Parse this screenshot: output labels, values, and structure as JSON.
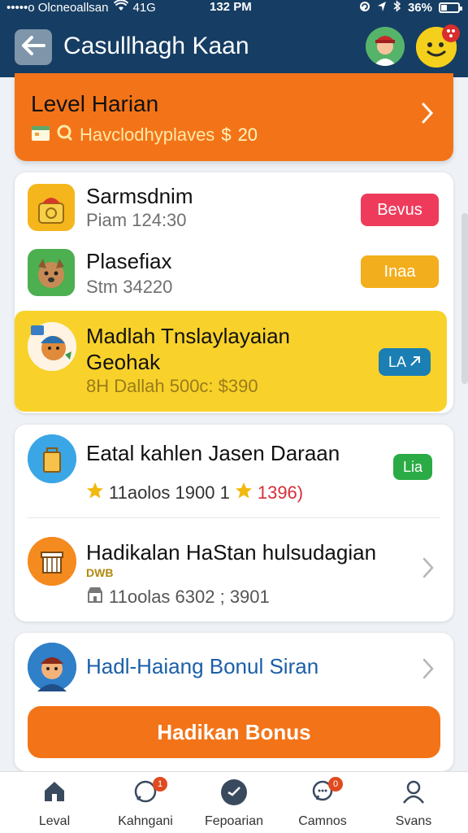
{
  "status_bar": {
    "carrier": "•••••o Olcneoallsan",
    "network": "41G",
    "time": "132 PM",
    "battery": "36%",
    "battery_level": 0.36
  },
  "header": {
    "title": "Casullhagh Kaan"
  },
  "notification_badge": {
    "color": "#d92e2e"
  },
  "level_card": {
    "title": "Level Harian",
    "subtitle": "Havclodhyplaves",
    "currency": "$",
    "amount": "20"
  },
  "list_1": [
    {
      "title": "Sarmsdnim",
      "subtitle": "Piam 124:30",
      "pill_label": "Bevus",
      "pill_color": "#ee3b5c",
      "icon": "bucket-toy-icon"
    },
    {
      "title": "Plasefiax",
      "subtitle": "Stm 34220",
      "pill_label": "Inaa",
      "pill_color": "#f2ae1c",
      "icon": "dog-avatar-icon"
    },
    {
      "title_line1": "Madlah Tnslaylayaian",
      "title_line2": "Geohak",
      "subtitle": "8H Dallah 500c: $390",
      "pill_label": "LA",
      "pill_color": "#1b7fb3",
      "icon": "character-avatar-icon"
    }
  ],
  "list_2": [
    {
      "title": "Eatal kahlen Jasen Daraan",
      "stat_1": "11aolos 1900 1",
      "stat_2": "1396)",
      "pill_label": "Lia",
      "pill_color": "#2bab45",
      "icon": "shopping-bag-icon"
    },
    {
      "title": "Hadikalan HaStan hulsudagian",
      "tag": "DWB",
      "stat": "11oolas 6302 ; 3901",
      "icon": "gift-box-icon"
    }
  ],
  "bonus_card": {
    "title": "Hadl-Haiang Bonul Siran",
    "button_label": "Hadikan Bonus"
  },
  "bottom_nav": [
    {
      "label": "Leval",
      "icon": "home-icon",
      "badge": ""
    },
    {
      "label": "Kahngani",
      "icon": "chat-icon",
      "badge": "1"
    },
    {
      "label": "Fepoarian",
      "icon": "compass-icon",
      "badge": ""
    },
    {
      "label": "Camnos",
      "icon": "message-icon",
      "badge": "0"
    },
    {
      "label": "Svans",
      "icon": "profile-icon",
      "badge": ""
    }
  ],
  "colors": {
    "header_bg": "#163d63",
    "accent_orange": "#f37418",
    "highlight_yellow": "#f8d22a",
    "link_blue": "#1b5fa8"
  }
}
